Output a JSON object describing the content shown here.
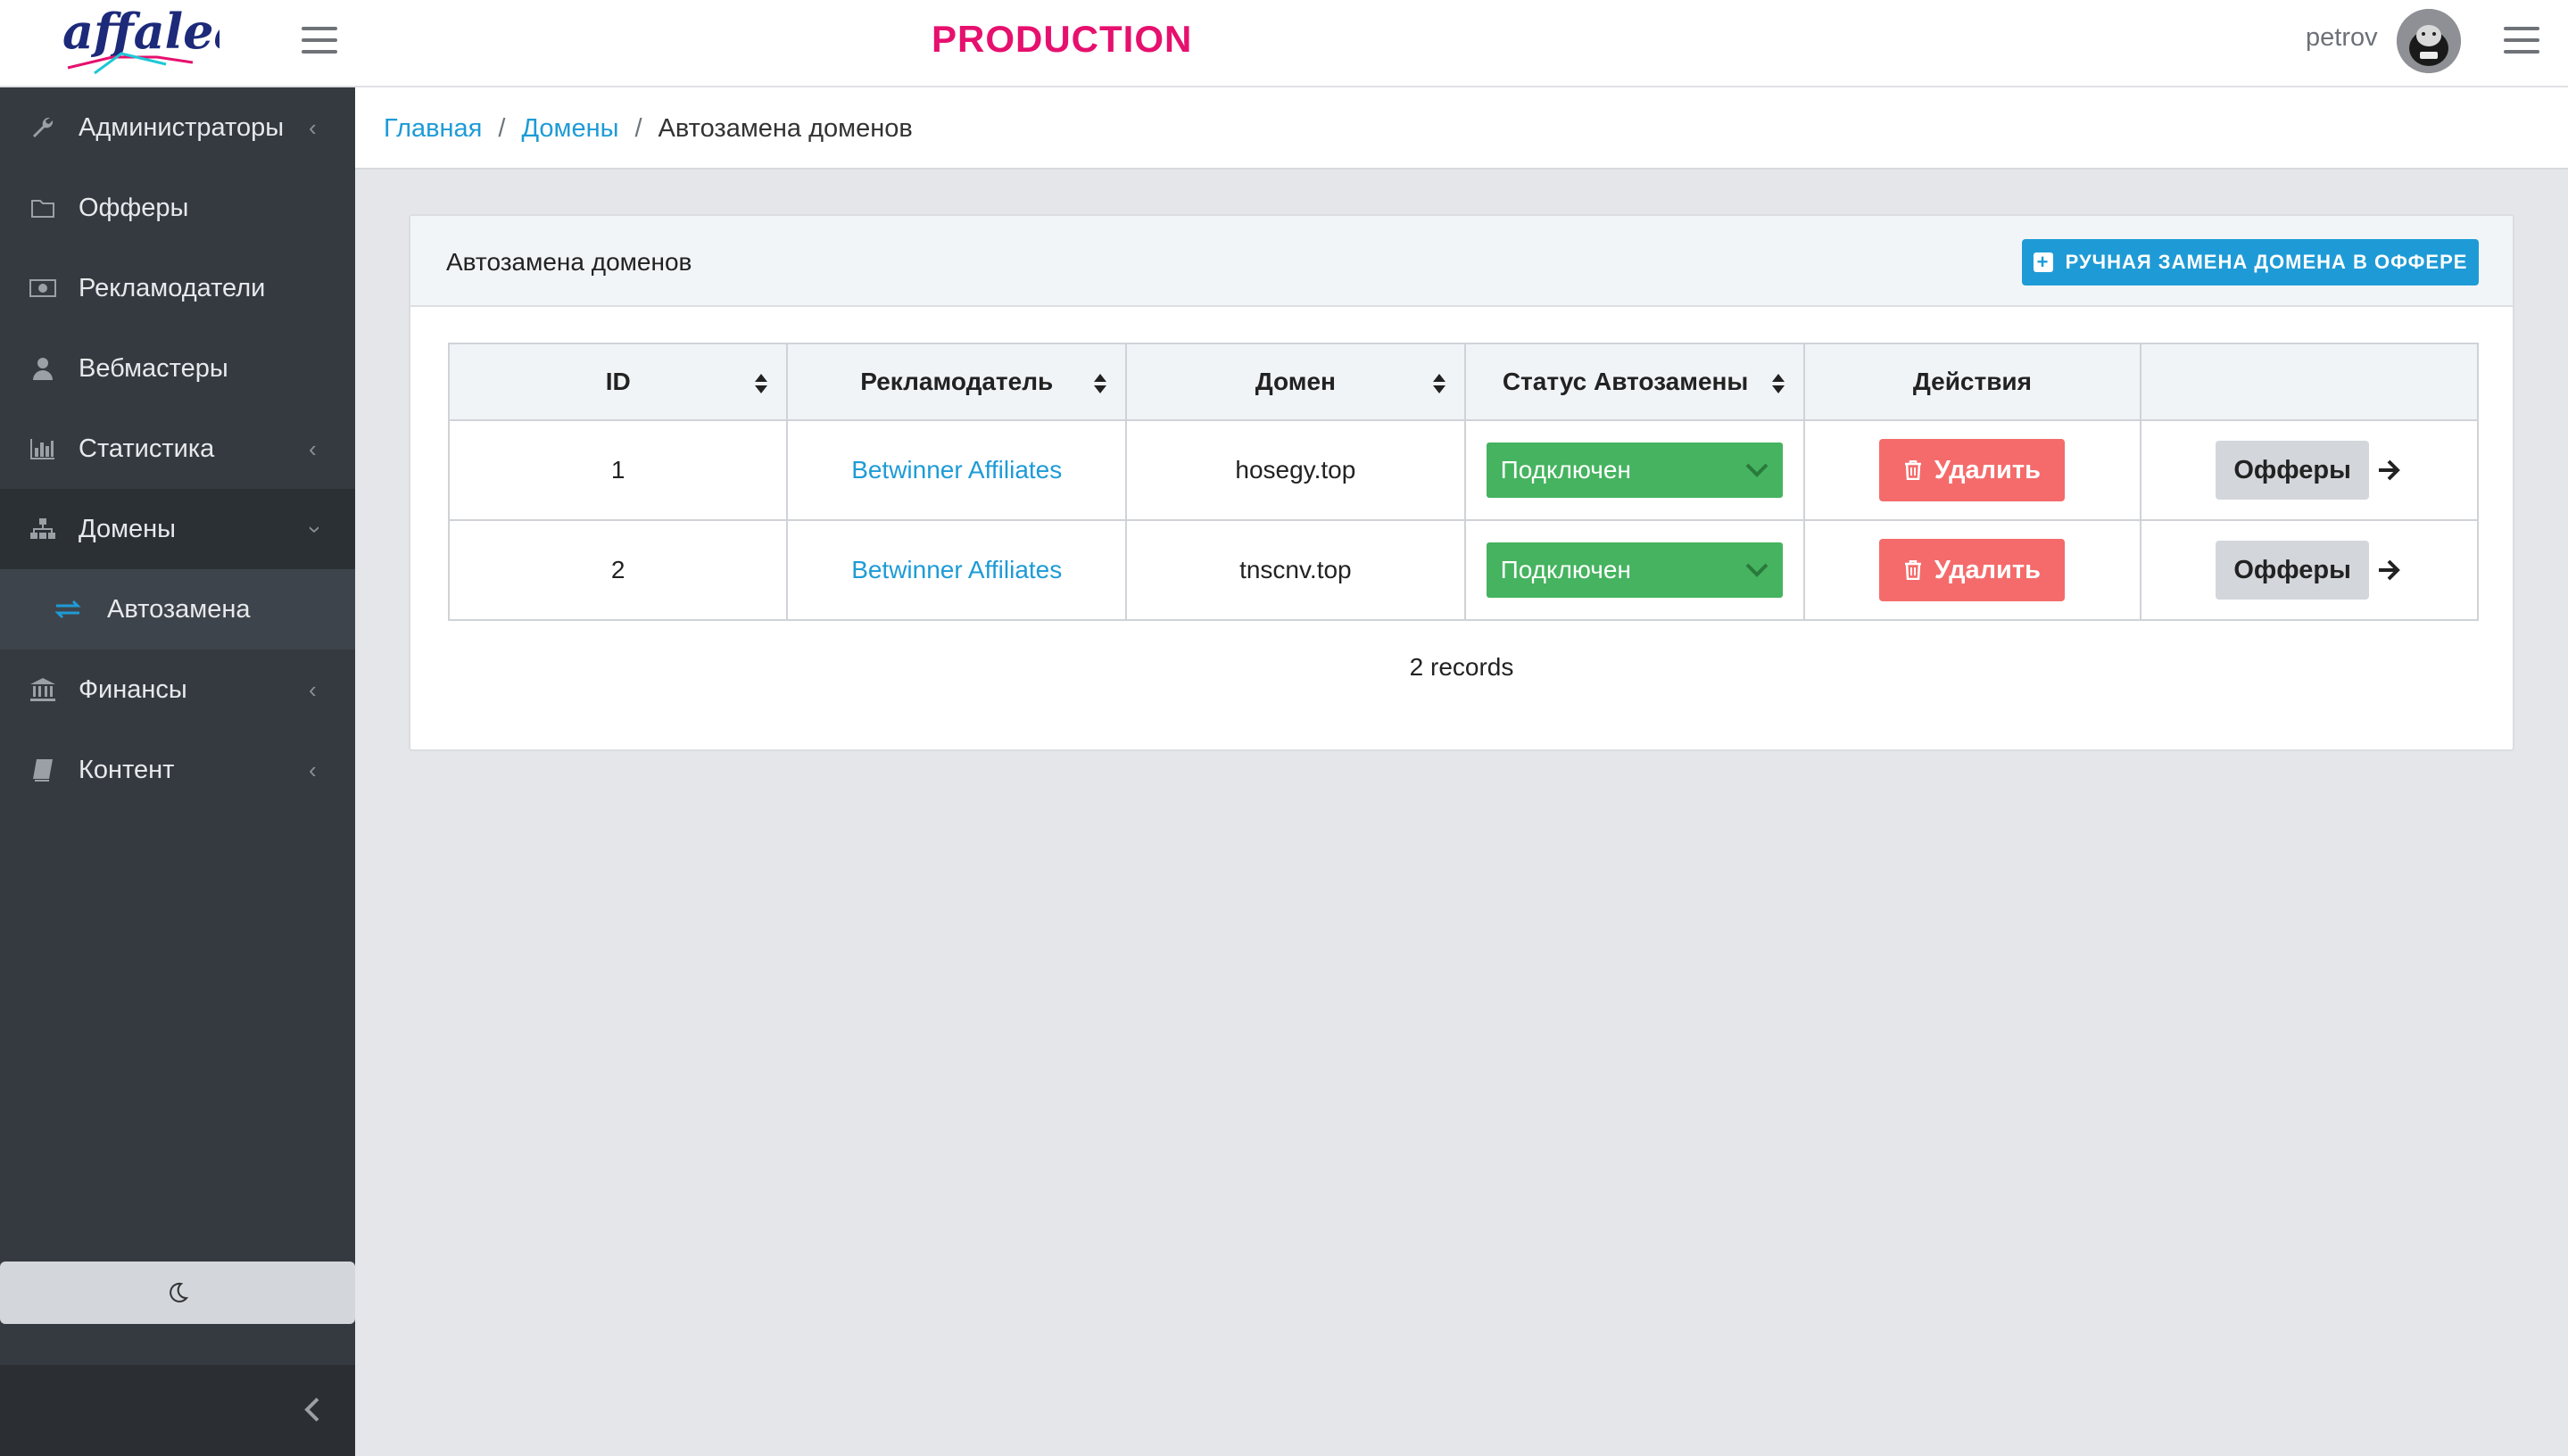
{
  "header": {
    "logo_text": "affaleads",
    "env_title": "PRODUCTION",
    "username": "petrov",
    "brand_color": "#e6106e"
  },
  "sidebar": {
    "items": [
      {
        "label": "Администраторы",
        "icon": "wrench-icon"
      },
      {
        "label": "Офферы",
        "icon": "folder-icon"
      },
      {
        "label": "Рекламодатели",
        "icon": "money-icon"
      },
      {
        "label": "Вебмастеры",
        "icon": "user-icon"
      },
      {
        "label": "Статистика",
        "icon": "bar-chart-icon"
      },
      {
        "label": "Домены",
        "icon": "sitemap-icon"
      },
      {
        "label": "Автозамена",
        "icon": "exchange-icon"
      },
      {
        "label": "Финансы",
        "icon": "bank-icon"
      },
      {
        "label": "Контент",
        "icon": "book-icon"
      }
    ]
  },
  "breadcrumb": {
    "home": "Главная",
    "sep": "/",
    "domains": "Домены",
    "current": "Автозамена доменов"
  },
  "card": {
    "title": "Автозамена доменов",
    "add_button": "РУЧНАЯ ЗАМЕНА ДОМЕНА В ОФФЕРЕ"
  },
  "table": {
    "headers": [
      "ID",
      "Рекламодатель",
      "Домен",
      "Статус Автозамены",
      "Действия",
      ""
    ],
    "rows": [
      {
        "id": "1",
        "advertiser": "Betwinner Affiliates",
        "domain": "hosegy.top",
        "status": "Подключен",
        "delete": "Удалить",
        "offers": "Офферы"
      },
      {
        "id": "2",
        "advertiser": "Betwinner Affiliates",
        "domain": "tnscnv.top",
        "status": "Подключен",
        "delete": "Удалить",
        "offers": "Офферы"
      }
    ],
    "records": "2 records"
  },
  "colors": {
    "accent": "#1e9bd6",
    "status_green": "#45b35f",
    "delete_red": "#f56b6b",
    "sidebar_bg": "#343a40"
  }
}
